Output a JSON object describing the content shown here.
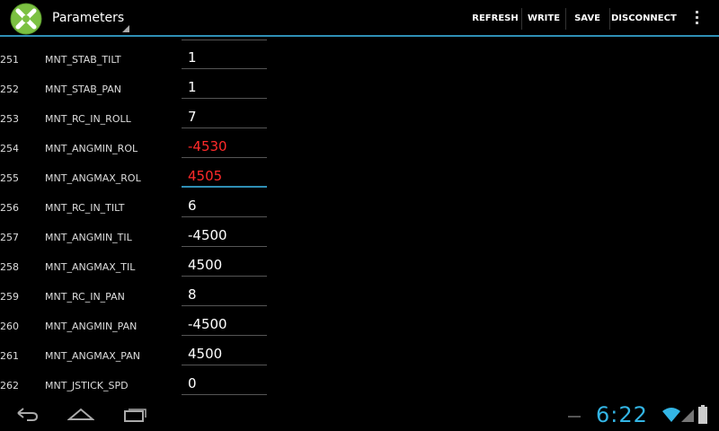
{
  "actionbar": {
    "title": "Parameters",
    "buttons": [
      "REFRESH",
      "WRITE",
      "SAVE",
      "DISCONNECT"
    ]
  },
  "params": [
    {
      "index": "251",
      "name": "MNT_STAB_TILT",
      "value": "1"
    },
    {
      "index": "252",
      "name": "MNT_STAB_PAN",
      "value": "1"
    },
    {
      "index": "253",
      "name": "MNT_RC_IN_ROLL",
      "value": "7"
    },
    {
      "index": "254",
      "name": "MNT_ANGMIN_ROL",
      "value": "-4530"
    },
    {
      "index": "255",
      "name": "MNT_ANGMAX_ROL",
      "value": "4505"
    },
    {
      "index": "256",
      "name": "MNT_RC_IN_TILT",
      "value": "6"
    },
    {
      "index": "257",
      "name": "MNT_ANGMIN_TIL",
      "value": "-4500"
    },
    {
      "index": "258",
      "name": "MNT_ANGMAX_TIL",
      "value": "4500"
    },
    {
      "index": "259",
      "name": "MNT_RC_IN_PAN",
      "value": "8"
    },
    {
      "index": "260",
      "name": "MNT_ANGMIN_PAN",
      "value": "-4500"
    },
    {
      "index": "261",
      "name": "MNT_ANGMAX_PAN",
      "value": "4500"
    },
    {
      "index": "262",
      "name": "MNT_JSTICK_SPD",
      "value": "0"
    }
  ],
  "statusbar": {
    "clock": "6:22"
  },
  "colors": {
    "accent": "#33b5e5",
    "changed_value": "#ff2a2a",
    "logo_green": "#7cc142"
  }
}
